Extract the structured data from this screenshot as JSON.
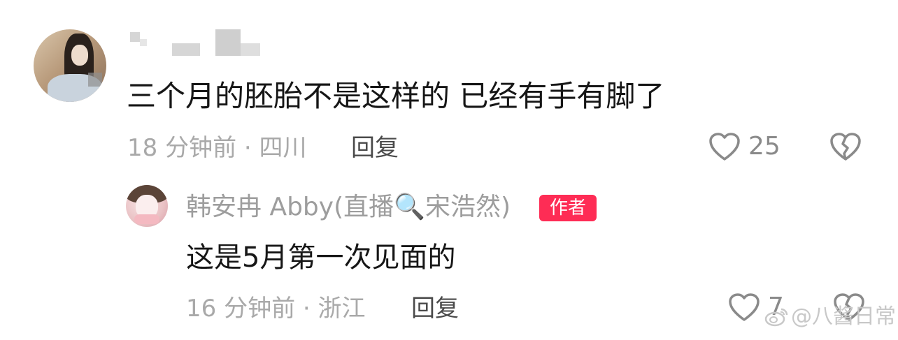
{
  "comment": {
    "text": "三个月的胚胎不是这样的 已经有手有脚了",
    "meta": "18 分钟前 · 四川",
    "reply_label": "回复",
    "likes": "25"
  },
  "reply": {
    "author": "韩安冉 Abby(直播🔍宋浩然)",
    "badge": "作者",
    "text": "这是5月第一次见面的",
    "meta": "16 分钟前 · 浙江",
    "reply_label": "回复",
    "likes": "7"
  },
  "watermark": {
    "text": "@八酱日常",
    "icon": "weibo-icon"
  },
  "colors": {
    "badge": "#fe2c55",
    "text": "#161616",
    "meta": "#a9a9a9",
    "icon": "#8a8a8a"
  }
}
